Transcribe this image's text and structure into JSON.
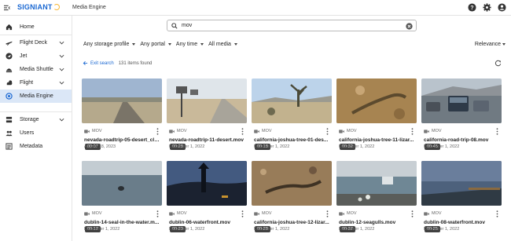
{
  "header": {
    "logo_text": "SIGNIANT",
    "app_title": "Media Engine",
    "icons": [
      "help-icon",
      "settings-icon",
      "account-icon"
    ]
  },
  "sidebar": {
    "items": [
      {
        "label": "Home",
        "icon": "home-icon",
        "expandable": false,
        "active": false
      },
      {
        "label": "Flight Deck",
        "icon": "flight-deck-icon",
        "expandable": true,
        "active": false
      },
      {
        "label": "Jet",
        "icon": "jet-icon",
        "expandable": true,
        "active": false
      },
      {
        "label": "Media Shuttle",
        "icon": "shuttle-icon",
        "expandable": true,
        "active": false
      },
      {
        "label": "Flight",
        "icon": "flight-icon",
        "expandable": true,
        "active": false
      },
      {
        "label": "Media Engine",
        "icon": "media-engine-icon",
        "expandable": false,
        "active": true
      },
      {
        "label": "Storage",
        "icon": "storage-icon",
        "expandable": true,
        "active": false
      },
      {
        "label": "Users",
        "icon": "users-icon",
        "expandable": false,
        "active": false
      },
      {
        "label": "Metadata",
        "icon": "metadata-icon",
        "expandable": false,
        "active": false
      }
    ]
  },
  "search": {
    "value": "mov"
  },
  "filters": {
    "storage_profile": "Any storage profile",
    "portal": "Any portal",
    "time": "Any time",
    "media": "All media",
    "sort": "Relevance"
  },
  "results": {
    "exit_label": "Exit search",
    "count_text": "131 items found"
  },
  "colors": {
    "accent": "#1967d2",
    "active_nav": "#dbe7f7"
  },
  "cards": [
    {
      "duration": "00:07",
      "type": "MOV",
      "name": "nevada-roadtrip-05-desert_cli...",
      "date": "August 18, 2023",
      "thumb": "desert-road"
    },
    {
      "duration": "00:28",
      "type": "MOV",
      "name": "nevada-roadtrip-11-desert.mov",
      "date": "December 1, 2022",
      "thumb": "mailbox-road"
    },
    {
      "duration": "00:18",
      "type": "MOV",
      "name": "california-joshua-tree-01-des...",
      "date": "December 1, 2022",
      "thumb": "joshua-tree"
    },
    {
      "duration": "00:32",
      "type": "MOV",
      "name": "california-joshua-tree-11-lizar...",
      "date": "December 1, 2022",
      "thumb": "lizard-rock"
    },
    {
      "duration": "00:45",
      "type": "MOV",
      "name": "california-road-trip-08.mov",
      "date": "December 1, 2022",
      "thumb": "traffic"
    },
    {
      "duration": "00:17",
      "type": "MOV",
      "name": "dublin-14-seal-in-the-water.m...",
      "date": "December 1, 2022",
      "thumb": "seal-water"
    },
    {
      "duration": "00:20",
      "type": "MOV",
      "name": "dublin-06-waterfront.mov",
      "date": "December 1, 2022",
      "thumb": "waterfront-dusk"
    },
    {
      "duration": "00:28",
      "type": "MOV",
      "name": "california-joshua-tree-12-lizar...",
      "date": "December 1, 2022",
      "thumb": "lizard-ground"
    },
    {
      "duration": "00:37",
      "type": "MOV",
      "name": "dublin-12-seagulls.mov",
      "date": "December 1, 2022",
      "thumb": "seagulls"
    },
    {
      "duration": "00:25",
      "type": "MOV",
      "name": "dublin-08-waterfront.mov",
      "date": "December 1, 2022",
      "thumb": "waterfront-evening"
    }
  ]
}
